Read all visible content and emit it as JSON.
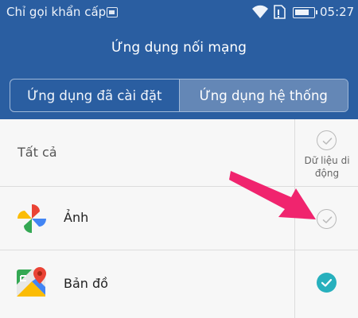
{
  "status_bar": {
    "carrier": "Chỉ gọi khẩn cấp",
    "time": "05:27",
    "icons": [
      "sim-card-icon",
      "wifi-icon",
      "sim-tray-icon",
      "battery-icon"
    ]
  },
  "header": {
    "title": "Ứng dụng nối mạng",
    "background_color": "#2a5ea1"
  },
  "tabs": [
    {
      "label": "Ứng dụng đã cài đặt",
      "selected": false
    },
    {
      "label": "Ứng dụng hệ thống",
      "selected": true
    }
  ],
  "list": {
    "all_label": "Tất cả",
    "column_header": "Dữ liệu di động",
    "all_checked": false,
    "apps": [
      {
        "name": "Ảnh",
        "icon": "google-photos-icon",
        "mobile_data": false
      },
      {
        "name": "Bản đồ",
        "icon": "google-maps-icon",
        "mobile_data": true
      }
    ]
  },
  "annotation": {
    "type": "arrow",
    "color": "#f0246e",
    "points_to": "Ảnh mobile data checkbox"
  },
  "colors": {
    "accent": "#27b0bd",
    "arrow": "#f0246e"
  }
}
